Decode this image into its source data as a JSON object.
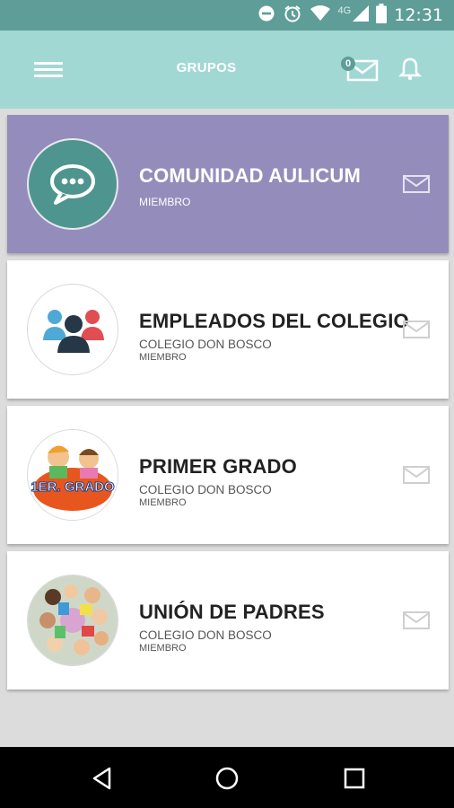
{
  "status_bar": {
    "network": "4G",
    "time": "12:31"
  },
  "app_bar": {
    "title": "GRUPOS",
    "unread_count": "0"
  },
  "groups": [
    {
      "name": "COMUNIDAD AULICUM",
      "role": "MIEMBRO",
      "active": true,
      "avatar_icon": "chat-bubble-icon"
    },
    {
      "name": "EMPLEADOS DEL COLEGIO",
      "school": "COLEGIO DON BOSCO",
      "role": "MIEMBRO",
      "avatar_icon": "people-icon"
    },
    {
      "name": "PRIMER GRADO",
      "school": "COLEGIO DON BOSCO",
      "role": "MIEMBRO",
      "avatar_text": "1ER. GRADO"
    },
    {
      "name": "UNIÓN DE PADRES",
      "school": "COLEGIO DON BOSCO",
      "role": "MIEMBRO",
      "avatar_icon": "children-photo"
    }
  ],
  "colors": {
    "status_bar": "#5f9d98",
    "app_bar": "#a2d8d4",
    "active_card": "#948dbb",
    "chat_avatar": "#4f958f"
  }
}
